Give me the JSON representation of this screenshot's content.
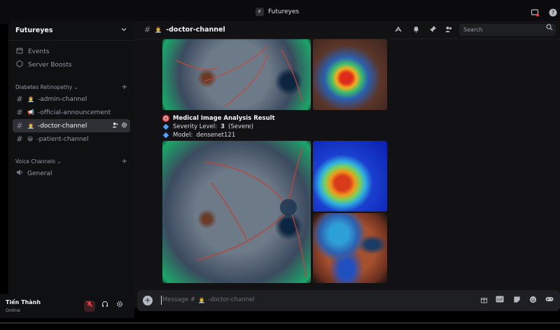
{
  "window": {
    "app_title": "Futureyes",
    "app_icon_letter": "F"
  },
  "sidebar": {
    "server_name": "Futureyes",
    "nav_items": [
      {
        "label": "Events",
        "icon": "calendar-icon"
      },
      {
        "label": "Server Boosts",
        "icon": "boost-icon"
      }
    ],
    "categories": [
      {
        "name": "Diabetes Retinopathy",
        "channels": [
          {
            "label": "-admin-channel",
            "emoji": "👨‍⚕️"
          },
          {
            "label": "-official-announcement",
            "emoji": "📢"
          },
          {
            "label": "-doctor-channel",
            "emoji": "👨‍⚕️",
            "active": true
          },
          {
            "label": "-patient-channel",
            "emoji": "😀"
          }
        ]
      },
      {
        "name": "Voice Channels",
        "channels": [
          {
            "label": "General",
            "icon": "speaker-icon"
          }
        ]
      }
    ]
  },
  "user": {
    "name": "Tiến Thành",
    "status": "Online"
  },
  "channel": {
    "name": "-doctor-channel",
    "emoji": "👨‍⚕️"
  },
  "search": {
    "placeholder": "Search"
  },
  "message": {
    "title": "Medical Image Analysis Result",
    "severity_label": "Severity Level:",
    "severity_value": "3",
    "severity_text": "(Severe)",
    "model_label": "Model:",
    "model_value": "densenet121"
  },
  "composer": {
    "placeholder_prefix": "Message #",
    "placeholder_channel": "-doctor-channel",
    "emoji": "👨‍⚕️"
  },
  "colors": {
    "accent": "#4aa3ff",
    "danger": "#f23f42",
    "active_bg": "#2e3035"
  }
}
